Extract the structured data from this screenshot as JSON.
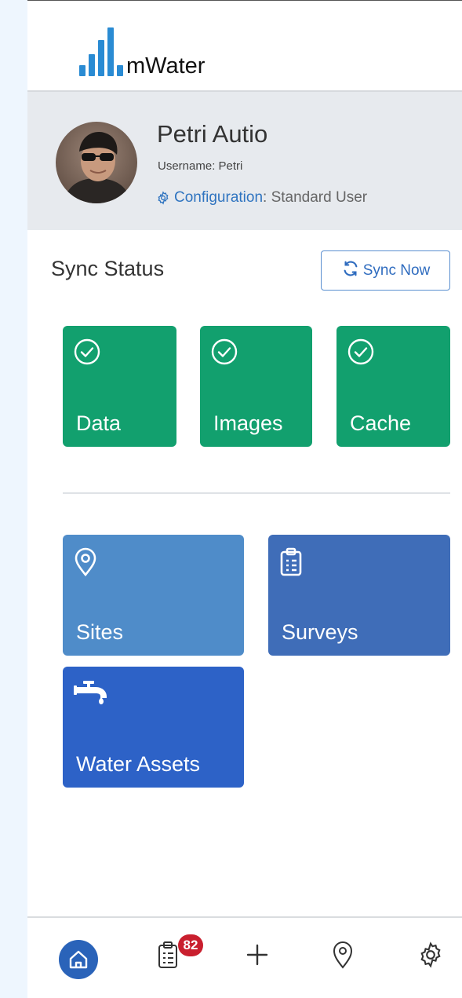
{
  "brand": {
    "name": "mWater",
    "accent": "#2a8bd3"
  },
  "profile": {
    "name": "Petri Autio",
    "username_label": "Username: Petri",
    "config_label": "Configuration",
    "config_value": ": Standard User"
  },
  "sync": {
    "title": "Sync Status",
    "button_label": "Sync Now",
    "tiles": [
      {
        "label": "Data",
        "icon": "check-circle-icon",
        "color": "#12a06e"
      },
      {
        "label": "Images",
        "icon": "check-circle-icon",
        "color": "#12a06e"
      },
      {
        "label": "Cache",
        "icon": "check-circle-icon",
        "color": "#12a06e"
      }
    ]
  },
  "nav_tiles": [
    {
      "label": "Sites",
      "icon": "map-pin-icon",
      "color": "#4f8cc9"
    },
    {
      "label": "Surveys",
      "icon": "clipboard-list-icon",
      "color": "#3f6db8"
    },
    {
      "label": "Water Assets",
      "icon": "faucet-icon",
      "color": "#2d62c7"
    }
  ],
  "bottom_nav": {
    "items": [
      "home-icon",
      "clipboard-list-icon",
      "plus-icon",
      "map-pin-icon",
      "gear-icon"
    ],
    "badge_count": "82",
    "active": "home-icon"
  }
}
